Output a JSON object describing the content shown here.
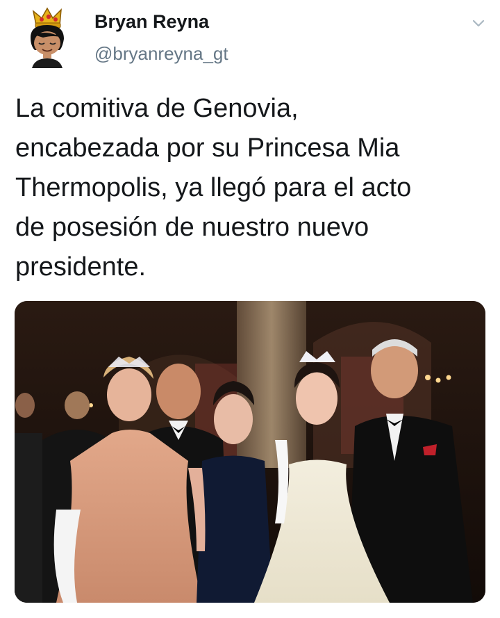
{
  "user": {
    "display_name": "Bryan Reyna",
    "handle": "@bryanreyna_gt",
    "avatar_icon": "crowned-cartoon-avatar"
  },
  "menu_icon": "chevron-down-icon",
  "tweet": {
    "text": "La comitiva de Genovia,\nencabezada por su Princesa Mia\nThermopolis, ya llegó para el acto\nde posesión de nuestro nuevo\npresidente."
  },
  "media": {
    "kind": "photo",
    "subject": "group-photo-five-people-formal-event"
  },
  "colors": {
    "text": "#14171a",
    "secondary": "#657786",
    "background": "#ffffff"
  }
}
